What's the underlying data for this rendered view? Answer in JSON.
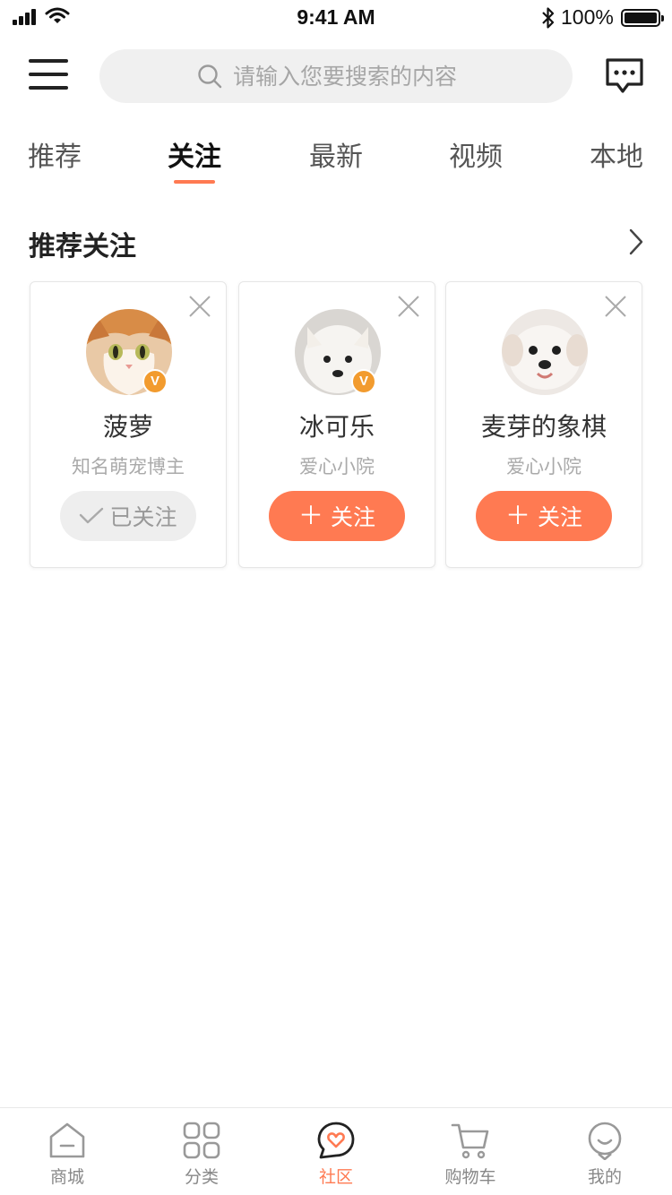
{
  "status_bar": {
    "time": "9:41 AM",
    "battery": "100%"
  },
  "header": {
    "search_placeholder": "请输入您要搜索的内容"
  },
  "tabs": [
    {
      "label": "推荐"
    },
    {
      "label": "关注"
    },
    {
      "label": "最新"
    },
    {
      "label": "视频"
    },
    {
      "label": "本地"
    }
  ],
  "active_tab": "关注",
  "recommend": {
    "title": "推荐关注",
    "cards": [
      {
        "name": "菠萝",
        "desc": "知名萌宠博主",
        "badge": "V",
        "button": "已关注",
        "followed": true
      },
      {
        "name": "冰可乐",
        "desc": "爱心小院",
        "badge": "V",
        "button": "关注",
        "followed": false
      },
      {
        "name": "麦芽的象棋",
        "desc": "爱心小院",
        "badge": "",
        "button": "关注",
        "followed": false
      }
    ]
  },
  "bottom_nav": [
    {
      "label": "商城",
      "icon": "home-icon"
    },
    {
      "label": "分类",
      "icon": "category-icon"
    },
    {
      "label": "社区",
      "icon": "community-icon"
    },
    {
      "label": "购物车",
      "icon": "cart-icon"
    },
    {
      "label": "我的",
      "icon": "profile-icon"
    }
  ],
  "active_nav": "社区",
  "colors": {
    "accent": "#ff7a52",
    "badge": "#f29b2e",
    "followed_bg": "#eeeeee"
  }
}
